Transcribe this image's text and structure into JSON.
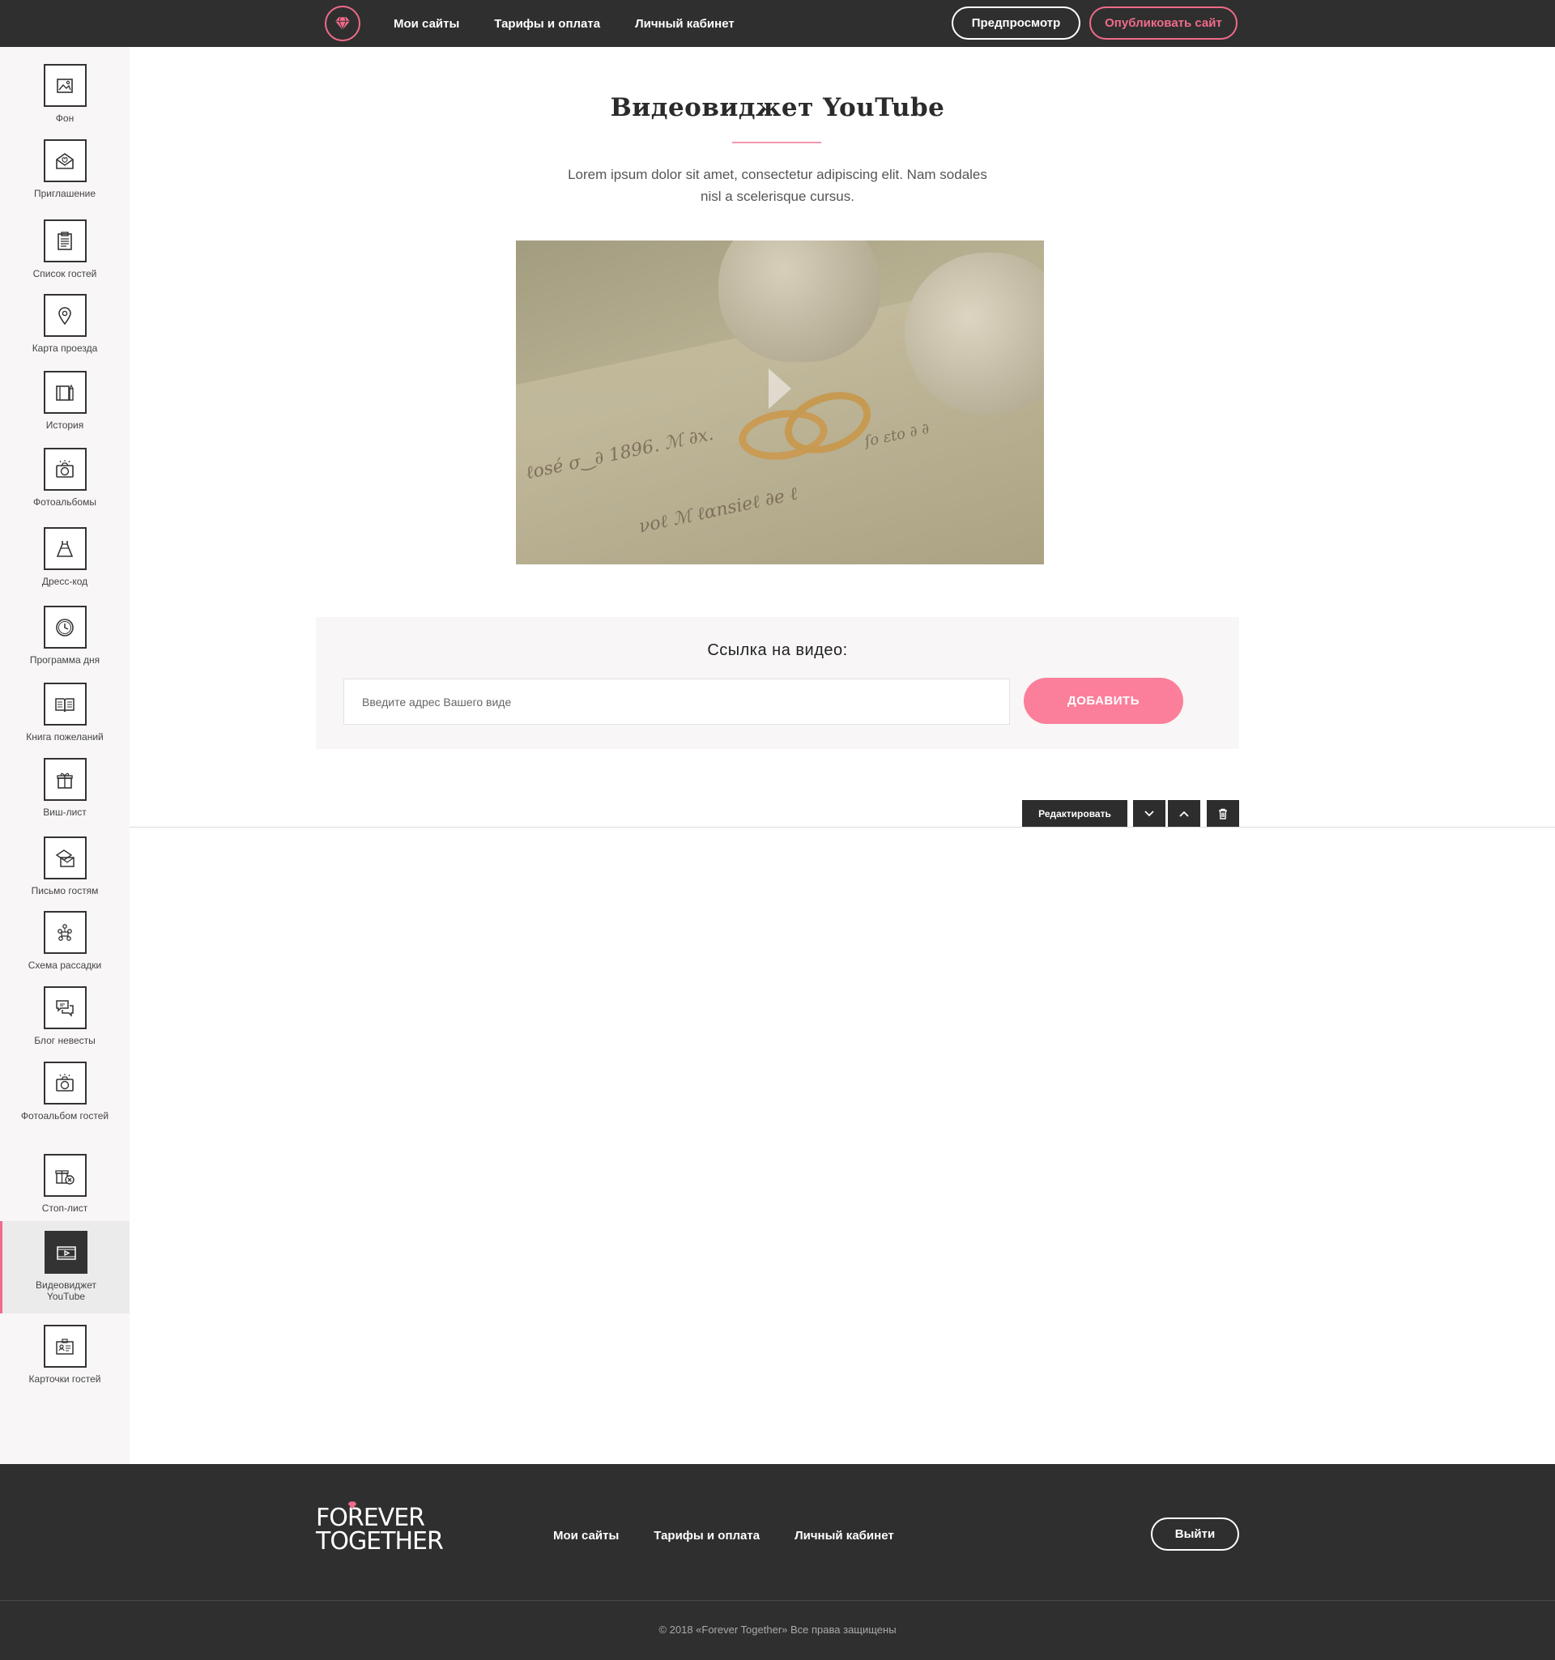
{
  "header": {
    "nav": [
      "Мои сайты",
      "Тарифы и оплата",
      "Личный кабинет"
    ],
    "preview_label": "Предпросмотр",
    "publish_label": "Опубликовать сайт"
  },
  "sidebar": {
    "items": [
      {
        "label": "Фон",
        "icon": "image-icon"
      },
      {
        "label": "Приглашение",
        "icon": "envelope-icon"
      },
      {
        "label": "Список гостей",
        "icon": "clipboard-icon"
      },
      {
        "label": "Карта проезда",
        "icon": "map-pin-icon"
      },
      {
        "label": "История",
        "icon": "book-icon"
      },
      {
        "label": "Фотоальбомы",
        "icon": "camera-icon"
      },
      {
        "label": "Дресс-код",
        "icon": "dress-icon"
      },
      {
        "label": "Программа дня",
        "icon": "clock-icon"
      },
      {
        "label": "Книга пожеланий",
        "icon": "open-book-icon"
      },
      {
        "label": "Виш-лист",
        "icon": "gift-icon"
      },
      {
        "label": "Письмо гостям",
        "icon": "letter-icon"
      },
      {
        "label": "Схема рассадки",
        "icon": "seating-icon"
      },
      {
        "label": "Блог невесты",
        "icon": "chat-icon"
      },
      {
        "label": "Фотоальбом гостей",
        "icon": "camera-icon"
      },
      {
        "label": "Стоп-лист",
        "icon": "gift-cancel-icon"
      },
      {
        "label": "Видеовиджет YouTube",
        "icon": "video-icon",
        "active": true
      },
      {
        "label": "Карточки гостей",
        "icon": "id-card-icon"
      }
    ]
  },
  "main": {
    "title": "Видеовиджет YouTube",
    "description": "Lorem ipsum dolor sit amet, consectetur adipiscing elit. Nam sodales nisl a scelerisque cursus.",
    "link_title": "Ссылка на видео:",
    "input_placeholder": "Введите адрес Вашего виде",
    "add_label": "ДОБАВИТЬ",
    "edit_label": "Редактировать"
  },
  "footer": {
    "logo_line1": "FOREVER",
    "logo_line2": "TOGETHER",
    "nav": [
      "Мои сайты",
      "Тарифы и оплата",
      "Личный кабинет"
    ],
    "logout_label": "Выйти",
    "copyright": "© 2018 «Forever Together» Все права защищены"
  },
  "colors": {
    "accent": "#f06b8a",
    "button_pink": "#fb7f9a",
    "dark": "#2f2f2f",
    "sidebar_bg": "#f8f6f6"
  }
}
